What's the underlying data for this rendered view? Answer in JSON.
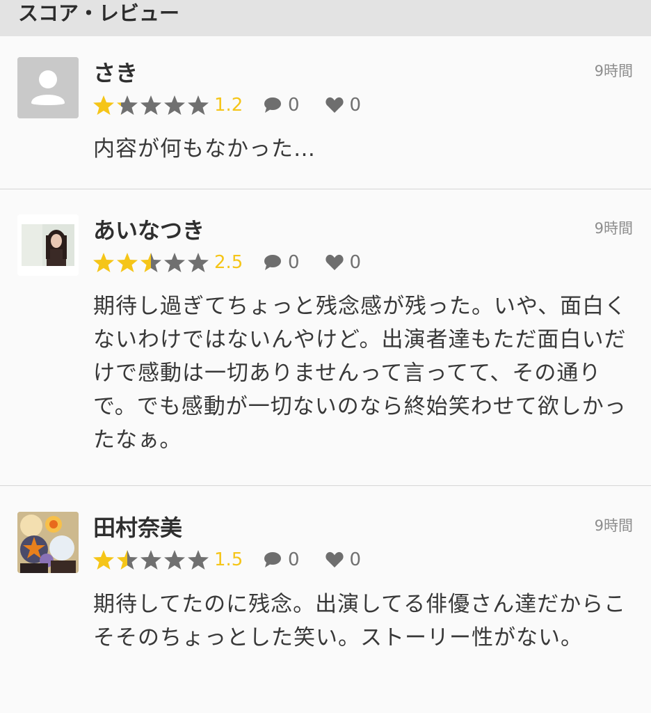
{
  "header": {
    "title": "スコア・レビュー"
  },
  "reviews": [
    {
      "user": "さき",
      "time": "9時間",
      "score": "1.2",
      "rating": 1.2,
      "comments": "0",
      "likes": "0",
      "text": "内容が何もなかった…",
      "avatar": "default-user-icon"
    },
    {
      "user": "あいなつき",
      "time": "9時間",
      "score": "2.5",
      "rating": 2.5,
      "comments": "0",
      "likes": "0",
      "text": "期待し過ぎてちょっと残念感が残った。いや、面白くないわけではないんやけど。出演者達もただ面白いだけで感動は一切ありませんって言ってて、その通りで。でも感動が一切ないのなら終始笑わせて欲しかったなぁ。",
      "avatar": "profile-photo"
    },
    {
      "user": "田村奈美",
      "time": "9時間",
      "score": "1.5",
      "rating": 1.5,
      "comments": "0",
      "likes": "0",
      "text": "期待してたのに残念。出演してる俳優さん達だからこそそのちょっとした笑い。ストーリー性がない。",
      "avatar": "snow-globe-photo"
    }
  ],
  "colors": {
    "star_on": "#f5c518",
    "star_off": "#707070",
    "icon": "#6e6e6e"
  }
}
